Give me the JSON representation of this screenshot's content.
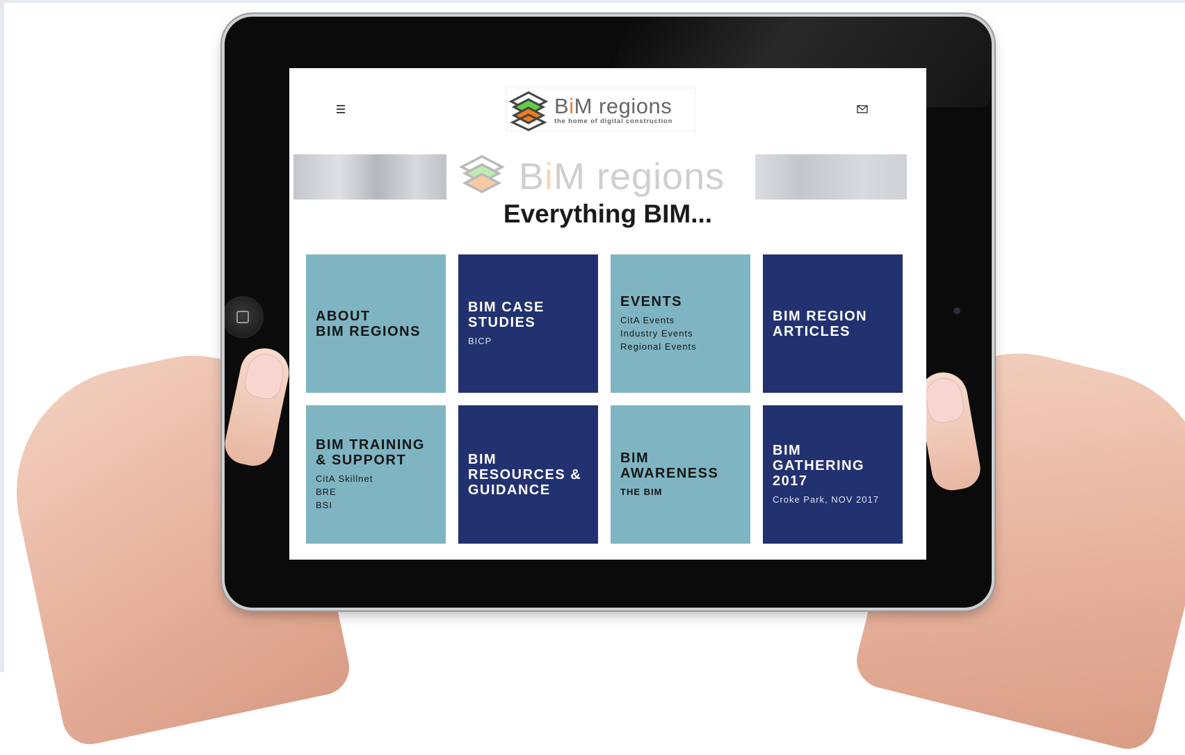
{
  "site": {
    "logo": {
      "title_pre": "B",
      "title_i": "i",
      "title_post": "M regions",
      "tagline": "the home of digital construction"
    },
    "banner": {
      "title_pre": "B",
      "title_i": "i",
      "title_post": "M regions"
    },
    "headline": "Everything BIM...",
    "colors": {
      "tile_light": "#7fb5c3",
      "tile_dark": "#223170",
      "logo_accent": "#ef7d1f",
      "logo_green": "#5fcf45"
    },
    "icons": {
      "menu": "hamburger-icon",
      "mail": "envelope-icon"
    }
  },
  "tiles": [
    {
      "title": "ABOUT BIM REGIONS",
      "title_line1": "ABOUT",
      "title_line2": "BIM REGIONS",
      "subs": []
    },
    {
      "title": "BIM CASE STUDIES",
      "title_line1": "BIM CASE",
      "title_line2": "STUDIES",
      "subs": [
        "BICP"
      ]
    },
    {
      "title": "EVENTS",
      "subs": [
        "CitA Events",
        "Industry Events",
        "Regional Events"
      ]
    },
    {
      "title": "BIM REGION ARTICLES",
      "title_line1": "BIM REGION",
      "title_line2": "ARTICLES",
      "subs": []
    },
    {
      "title": "BIM TRAINING & SUPPORT",
      "title_line1": "BIM TRAINING",
      "title_line2": "& SUPPORT",
      "subs": [
        "CitA Skillnet",
        "BRE",
        "BSI"
      ]
    },
    {
      "title": "BIM RESOURCES & GUIDANCE",
      "title_line1": "BIM",
      "title_line2": "RESOURCES &",
      "title_line3": "GUIDANCE",
      "subs": []
    },
    {
      "title": "BIM AWARENESS",
      "title_line1": "BIM",
      "title_line2": "AWARENESS",
      "subs": [
        "THE BIM"
      ]
    },
    {
      "title": "BIM GATHERING 2017",
      "title_line1": "BIM",
      "title_line2": "GATHERING",
      "title_line3": "2017",
      "subs": [
        "Croke Park, NOV 2017"
      ]
    }
  ]
}
